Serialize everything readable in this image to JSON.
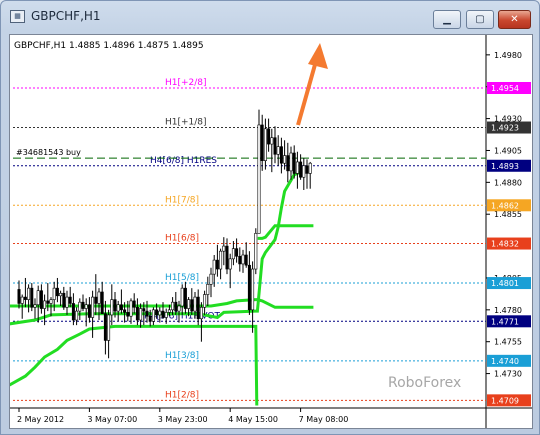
{
  "window": {
    "title": "GBPCHF,H1",
    "icon": "chart-window-icon",
    "buttons": {
      "minimize": "minimize-icon",
      "maximize": "maximize-icon",
      "close": "close-icon"
    }
  },
  "chart": {
    "header": "GBPCHF,H1  1.4885 1.4896 1.4875 1.4895",
    "watermark": "RoboForex",
    "colors": {
      "background": "#ffffff",
      "candles": "#000000",
      "ma_green": "#22dd22",
      "arrow": "#f47a30",
      "order_line": "#006600"
    }
  },
  "chart_data": {
    "type": "candlestick",
    "symbol": "GBPCHF",
    "timeframe": "H1",
    "ohlc_header": {
      "open": 1.4885,
      "high": 1.4896,
      "low": 1.4875,
      "close": 1.4895
    },
    "ylim": [
      1.4703,
      1.4994
    ],
    "y_ticks": [
      1.498,
      1.4955,
      1.493,
      1.4905,
      1.488,
      1.4855,
      1.4805,
      1.478,
      1.4755,
      1.473
    ],
    "x_ticks": [
      "2 May 2012",
      "3 May 07:00",
      "3 May 23:00",
      "4 May 15:00",
      "7 May 08:00"
    ],
    "levels": [
      {
        "label": "H1[+2/8]",
        "value": 1.4954,
        "price_label": "1.4954",
        "color": "#ff00ff"
      },
      {
        "label": "H1[+1/8]",
        "value": 1.4923,
        "price_label": "1.4923",
        "color": "#333333"
      },
      {
        "label": "H4[6/8] H1RES",
        "value": 1.4893,
        "price_label": "1.4893",
        "color": "#000080"
      },
      {
        "label": "H1[7/8]",
        "value": 1.4862,
        "price_label": "1.4862",
        "color": "#f5a623"
      },
      {
        "label": "H1[6/8]",
        "value": 1.4832,
        "price_label": "1.4832",
        "color": "#e8401c"
      },
      {
        "label": "H1[5/8]",
        "value": 1.4801,
        "price_label": "1.4801",
        "color": "#1a9fd6"
      },
      {
        "label": "H4[5/8] H1PIVOT",
        "value": 1.4771,
        "price_label": "1.4771",
        "color": "#000080"
      },
      {
        "label": "H1[3/8]",
        "value": 1.474,
        "price_label": "1.4740",
        "color": "#1a9fd6"
      },
      {
        "label": "H1[2/8]",
        "value": 1.4709,
        "price_label": "1.4709",
        "color": "#e8401c"
      }
    ],
    "order": {
      "label": "#34681543 buy",
      "value": 1.4899
    },
    "green_lines": [
      [
        [
          -3,
          1.4721
        ],
        [
          2,
          1.4728
        ],
        [
          5,
          1.4735
        ],
        [
          8,
          1.4743
        ],
        [
          12,
          1.4749
        ],
        [
          15,
          1.4756
        ],
        [
          19,
          1.4761
        ],
        [
          22,
          1.4765
        ],
        [
          30,
          1.4767
        ],
        [
          36,
          1.4767
        ],
        [
          72,
          1.4767
        ],
        [
          74,
          1.4767
        ],
        [
          74.3,
          1.4705
        ]
      ],
      [
        [
          -3,
          1.4769
        ],
        [
          5,
          1.4772
        ],
        [
          10,
          1.4776
        ],
        [
          22,
          1.4777
        ],
        [
          40,
          1.4777
        ],
        [
          56,
          1.4777
        ],
        [
          62,
          1.4774
        ],
        [
          64,
          1.4778
        ],
        [
          74,
          1.4779
        ],
        [
          74.5,
          1.4779
        ],
        [
          76,
          1.482
        ],
        [
          77,
          1.4825
        ],
        [
          80,
          1.4835
        ],
        [
          81,
          1.4845
        ],
        [
          82,
          1.486
        ],
        [
          83,
          1.4873
        ],
        [
          86,
          1.4886
        ],
        [
          88,
          1.4888
        ]
      ],
      [
        [
          -3,
          1.4783
        ],
        [
          20,
          1.4783
        ],
        [
          60,
          1.4783
        ],
        [
          65,
          1.4785
        ],
        [
          68,
          1.4787
        ],
        [
          74,
          1.4788
        ],
        [
          74.6,
          1.4788
        ],
        [
          76,
          1.4787
        ],
        [
          80,
          1.4782
        ],
        [
          83,
          1.4782
        ],
        [
          92,
          1.4782
        ]
      ],
      [
        [
          74.6,
          1.4836
        ],
        [
          76,
          1.4836
        ],
        [
          77,
          1.4837
        ],
        [
          80,
          1.4846
        ],
        [
          92,
          1.4846
        ]
      ]
    ],
    "candles": [
      [
        1.4796,
        1.4803,
        1.4781,
        1.4785
      ],
      [
        1.4785,
        1.4792,
        1.4773,
        1.479
      ],
      [
        1.479,
        1.4805,
        1.4782,
        1.4788
      ],
      [
        1.4788,
        1.48,
        1.4778,
        1.4797
      ],
      [
        1.4797,
        1.4801,
        1.4779,
        1.4782
      ],
      [
        1.4782,
        1.4789,
        1.4773,
        1.4784
      ],
      [
        1.4784,
        1.4799,
        1.477,
        1.4795
      ],
      [
        1.4795,
        1.48,
        1.4777,
        1.4781
      ],
      [
        1.4781,
        1.4792,
        1.4768,
        1.4787
      ],
      [
        1.4787,
        1.4801,
        1.4779,
        1.4785
      ],
      [
        1.4785,
        1.479,
        1.4775,
        1.4788
      ],
      [
        1.4788,
        1.4802,
        1.4779,
        1.4797
      ],
      [
        1.4797,
        1.4805,
        1.4786,
        1.4791
      ],
      [
        1.4791,
        1.4795,
        1.4783,
        1.4793
      ],
      [
        1.4793,
        1.4798,
        1.478,
        1.4782
      ],
      [
        1.4782,
        1.4795,
        1.4776,
        1.479
      ],
      [
        1.479,
        1.4798,
        1.4782,
        1.4785
      ],
      [
        1.4785,
        1.4793,
        1.4768,
        1.4772
      ],
      [
        1.4772,
        1.4782,
        1.4768,
        1.4779
      ],
      [
        1.4779,
        1.4789,
        1.4772,
        1.4786
      ],
      [
        1.4786,
        1.4792,
        1.4779,
        1.4781
      ],
      [
        1.4781,
        1.4789,
        1.4767,
        1.4784
      ],
      [
        1.4784,
        1.479,
        1.477,
        1.4774
      ],
      [
        1.4774,
        1.4795,
        1.4758,
        1.479
      ],
      [
        1.479,
        1.4808,
        1.4776,
        1.4785
      ],
      [
        1.4785,
        1.4797,
        1.4772,
        1.4794
      ],
      [
        1.4794,
        1.4802,
        1.4778,
        1.4777
      ],
      [
        1.4777,
        1.4787,
        1.4745,
        1.4756
      ],
      [
        1.4756,
        1.478,
        1.4742,
        1.4776
      ],
      [
        1.4776,
        1.48,
        1.4768,
        1.4788
      ],
      [
        1.4788,
        1.4794,
        1.4774,
        1.4779
      ],
      [
        1.4779,
        1.4787,
        1.4771,
        1.4784
      ],
      [
        1.4784,
        1.4796,
        1.4777,
        1.478
      ],
      [
        1.478,
        1.4786,
        1.477,
        1.4778
      ],
      [
        1.4778,
        1.4787,
        1.4771,
        1.4775
      ],
      [
        1.4775,
        1.4789,
        1.4769,
        1.4787
      ],
      [
        1.4787,
        1.4793,
        1.4777,
        1.4782
      ],
      [
        1.4782,
        1.4789,
        1.4768,
        1.4772
      ],
      [
        1.4772,
        1.4785,
        1.4766,
        1.4781
      ],
      [
        1.4781,
        1.4786,
        1.4768,
        1.4779
      ],
      [
        1.4779,
        1.4787,
        1.477,
        1.4775
      ],
      [
        1.4775,
        1.478,
        1.4767,
        1.4771
      ],
      [
        1.4771,
        1.4782,
        1.4768,
        1.478
      ],
      [
        1.478,
        1.4785,
        1.4773,
        1.4776
      ],
      [
        1.4776,
        1.4782,
        1.477,
        1.4779
      ],
      [
        1.4779,
        1.4786,
        1.4773,
        1.4774
      ],
      [
        1.4774,
        1.4781,
        1.4769,
        1.4778
      ],
      [
        1.4778,
        1.4784,
        1.4775,
        1.478
      ],
      [
        1.478,
        1.479,
        1.4776,
        1.4786
      ],
      [
        1.4786,
        1.4794,
        1.4776,
        1.4779
      ],
      [
        1.4779,
        1.4787,
        1.477,
        1.4783
      ],
      [
        1.4783,
        1.48,
        1.4776,
        1.4797
      ],
      [
        1.4797,
        1.4802,
        1.4777,
        1.4781
      ],
      [
        1.4781,
        1.479,
        1.4775,
        1.4788
      ],
      [
        1.4788,
        1.4797,
        1.4776,
        1.4779
      ],
      [
        1.4779,
        1.4794,
        1.4773,
        1.479
      ],
      [
        1.479,
        1.4796,
        1.4768,
        1.4773
      ],
      [
        1.4773,
        1.4786,
        1.4755,
        1.4782
      ],
      [
        1.4782,
        1.4795,
        1.4776,
        1.4792
      ],
      [
        1.4792,
        1.4806,
        1.4783,
        1.48
      ],
      [
        1.48,
        1.4813,
        1.479,
        1.4808
      ],
      [
        1.4808,
        1.4823,
        1.4798,
        1.4819
      ],
      [
        1.4819,
        1.4831,
        1.4806,
        1.4812
      ],
      [
        1.4812,
        1.4828,
        1.4804,
        1.4826
      ],
      [
        1.4826,
        1.4837,
        1.4815,
        1.483
      ],
      [
        1.483,
        1.4836,
        1.4808,
        1.4812
      ],
      [
        1.4812,
        1.4824,
        1.4797,
        1.482
      ],
      [
        1.482,
        1.4834,
        1.4815,
        1.4828
      ],
      [
        1.4828,
        1.4836,
        1.4817,
        1.4822
      ],
      [
        1.4822,
        1.4829,
        1.481,
        1.4816
      ],
      [
        1.4816,
        1.4827,
        1.4809,
        1.4823
      ],
      [
        1.4823,
        1.4833,
        1.4813,
        1.4815
      ],
      [
        1.4815,
        1.4826,
        1.4776,
        1.478
      ],
      [
        1.478,
        1.4818,
        1.4762,
        1.4812
      ],
      [
        1.4812,
        1.4844,
        1.4808,
        1.484
      ],
      [
        1.484,
        1.4937,
        1.4876,
        1.4925
      ],
      [
        1.4925,
        1.4933,
        1.4889,
        1.4897
      ],
      [
        1.4897,
        1.493,
        1.489,
        1.4922
      ],
      [
        1.4922,
        1.493,
        1.4904,
        1.491
      ],
      [
        1.491,
        1.4922,
        1.4888,
        1.4915
      ],
      [
        1.4915,
        1.4924,
        1.4895,
        1.4902
      ],
      [
        1.4902,
        1.4917,
        1.4893,
        1.4908
      ],
      [
        1.4908,
        1.4915,
        1.4887,
        1.4895
      ],
      [
        1.4895,
        1.4913,
        1.489,
        1.4901
      ],
      [
        1.4901,
        1.4911,
        1.488,
        1.4889
      ],
      [
        1.4889,
        1.4908,
        1.4882,
        1.4903
      ],
      [
        1.4903,
        1.4909,
        1.4883,
        1.4887
      ],
      [
        1.4887,
        1.4904,
        1.4875,
        1.4896
      ],
      [
        1.4896,
        1.4902,
        1.4882,
        1.4884
      ],
      [
        1.4884,
        1.4899,
        1.4874,
        1.4893
      ],
      [
        1.4893,
        1.4898,
        1.4875,
        1.4887
      ],
      [
        1.4887,
        1.4896,
        1.4875,
        1.4895
      ]
    ]
  }
}
